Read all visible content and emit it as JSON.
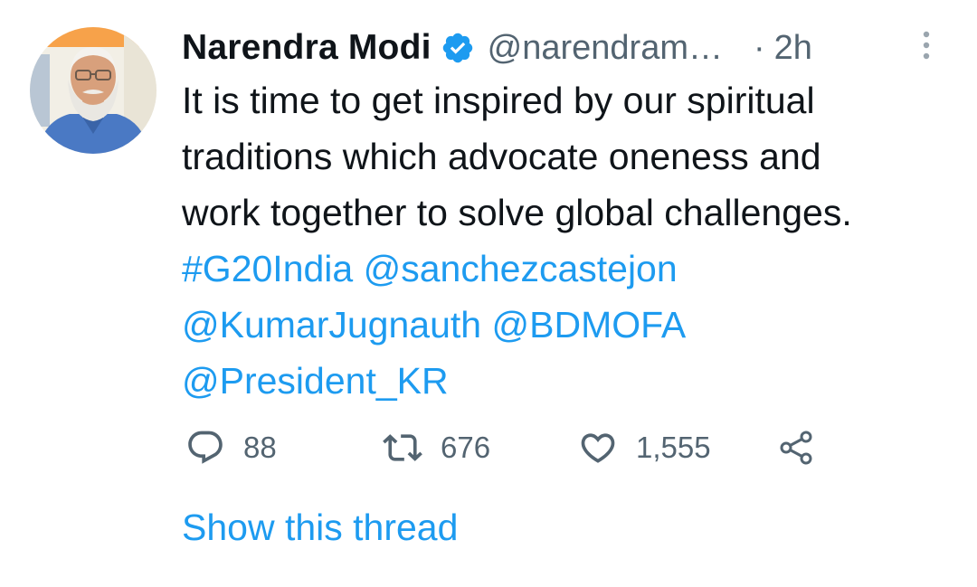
{
  "author": {
    "name": "Narendra Modi",
    "handle": "@narendram…",
    "separator": "·",
    "time": "2h",
    "verified_icon": "verified-badge-icon",
    "avatar_icon": "profile-photo"
  },
  "tweet": {
    "line1": "It is time to get inspired by our spiritual",
    "line2": "traditions which advocate oneness and",
    "line3": "work together to solve global challenges.",
    "hashtag": "#G20India",
    "mention1": "@sanchezcastejon",
    "mention2": "@KumarJugnauth",
    "mention3": "@BDMOFA",
    "mention4": "@President_KR"
  },
  "actions": {
    "reply_count": "88",
    "retweet_count": "676",
    "like_count": "1,555",
    "icons": [
      "reply-icon",
      "retweet-icon",
      "like-icon",
      "share-icon"
    ]
  },
  "show_thread_label": "Show this thread",
  "colors": {
    "link": "#1d9bf0",
    "text": "#0f1419",
    "muted": "#536471"
  }
}
